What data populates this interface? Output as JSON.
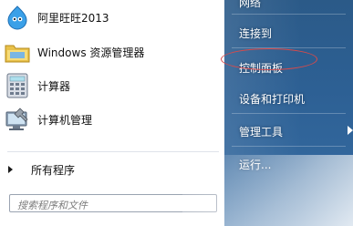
{
  "programs": [
    {
      "label": "阿里旺旺2013",
      "icon": "aliwangwang-icon"
    },
    {
      "label": "Windows 资源管理器",
      "icon": "folder-icon"
    },
    {
      "label": "计算器",
      "icon": "calculator-icon"
    },
    {
      "label": "计算机管理",
      "icon": "computer-management-icon"
    }
  ],
  "all_programs_label": "所有程序",
  "search": {
    "placeholder": "搜索程序和文件"
  },
  "right_panel": {
    "items": [
      {
        "label": "网络"
      },
      {
        "label": "连接到"
      },
      {
        "label": "控制面板"
      },
      {
        "label": "设备和打印机"
      },
      {
        "label": "管理工具"
      },
      {
        "label": "运行..."
      }
    ]
  },
  "colors": {
    "panel": "#2d6094",
    "annotation": "#d94a4a"
  }
}
